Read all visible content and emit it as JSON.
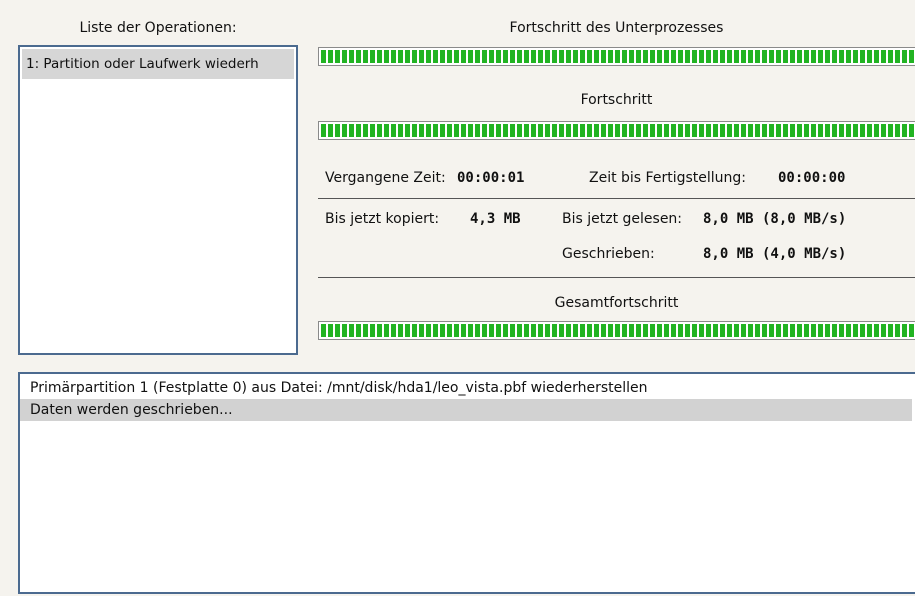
{
  "operations": {
    "title": "Liste der Operationen:",
    "items": [
      "1: Partition oder Laufwerk wiederh"
    ]
  },
  "subprocess": {
    "label": "Fortschritt des Unterprozesses",
    "progress": 1.0
  },
  "progress": {
    "label": "Fortschritt",
    "value": 1.0
  },
  "time": {
    "elapsed_label": "Vergangene Zeit:",
    "elapsed_value": "00:00:01",
    "remaining_label": "Zeit bis Fertigstellung:",
    "remaining_value": "00:00:00"
  },
  "stats": {
    "copied_label": "Bis jetzt kopiert:",
    "copied_value": "4,3 MB",
    "read_label": "Bis jetzt gelesen:",
    "read_value": "8,0 MB (8,0 MB/s)",
    "written_label": "Geschrieben:",
    "written_value": "8,0 MB (4,0 MB/s)"
  },
  "overall": {
    "label": "Gesamtfortschritt",
    "progress": 1.0
  },
  "log": {
    "lines": [
      "Primärpartition 1 (Festplatte 0) aus Datei: /mnt/disk/hda1/leo_vista.pbf wiederherstellen",
      "Daten werden geschrieben..."
    ]
  },
  "colors": {
    "background": "#f5f3ee",
    "progress_fill": "#22b322",
    "list_border": "#4b6a8f",
    "selection": "#d6d6d6"
  }
}
